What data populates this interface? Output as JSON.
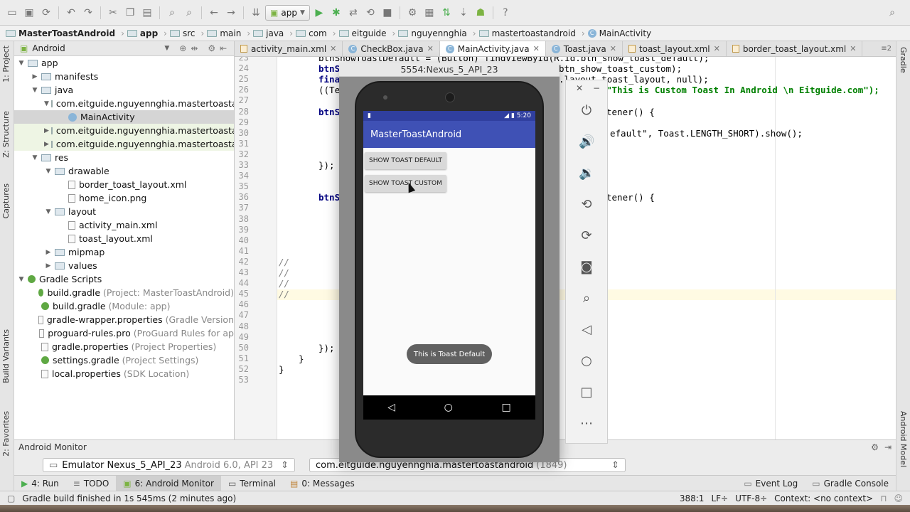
{
  "toolbar": {
    "run_config": "app"
  },
  "breadcrumb": [
    "MasterToastAndroid",
    "app",
    "src",
    "main",
    "java",
    "com",
    "eitguide",
    "nguyennghia",
    "mastertoastandroid",
    "MainActivity"
  ],
  "project": {
    "view_selector": "Android",
    "tree": [
      {
        "indent": 0,
        "arrow": "▼",
        "icon": "folder",
        "label": "app",
        "hint": ""
      },
      {
        "indent": 1,
        "arrow": "▶",
        "icon": "folder",
        "label": "manifests",
        "hint": ""
      },
      {
        "indent": 1,
        "arrow": "▼",
        "icon": "folder",
        "label": "java",
        "hint": ""
      },
      {
        "indent": 2,
        "arrow": "▼",
        "icon": "pkg",
        "label": "com.eitguide.nguyennghia.mastertoasta",
        "hint": ""
      },
      {
        "indent": 3,
        "arrow": "",
        "icon": "class",
        "label": "MainActivity",
        "hint": ""
      },
      {
        "indent": 2,
        "arrow": "▶",
        "icon": "pkg",
        "label": "com.eitguide.nguyennghia.mastertoasta",
        "hint": ""
      },
      {
        "indent": 2,
        "arrow": "▶",
        "icon": "pkg",
        "label": "com.eitguide.nguyennghia.mastertoasta",
        "hint": ""
      },
      {
        "indent": 1,
        "arrow": "▼",
        "icon": "folder",
        "label": "res",
        "hint": ""
      },
      {
        "indent": 2,
        "arrow": "▼",
        "icon": "folder",
        "label": "drawable",
        "hint": ""
      },
      {
        "indent": 3,
        "arrow": "",
        "icon": "file",
        "label": "border_toast_layout.xml",
        "hint": ""
      },
      {
        "indent": 3,
        "arrow": "",
        "icon": "file",
        "label": "home_icon.png",
        "hint": ""
      },
      {
        "indent": 2,
        "arrow": "▼",
        "icon": "folder",
        "label": "layout",
        "hint": ""
      },
      {
        "indent": 3,
        "arrow": "",
        "icon": "file",
        "label": "activity_main.xml",
        "hint": ""
      },
      {
        "indent": 3,
        "arrow": "",
        "icon": "file",
        "label": "toast_layout.xml",
        "hint": ""
      },
      {
        "indent": 2,
        "arrow": "▶",
        "icon": "folder",
        "label": "mipmap",
        "hint": ""
      },
      {
        "indent": 2,
        "arrow": "▶",
        "icon": "folder",
        "label": "values",
        "hint": ""
      },
      {
        "indent": 0,
        "arrow": "▼",
        "icon": "gradle",
        "label": "Gradle Scripts",
        "hint": ""
      },
      {
        "indent": 1,
        "arrow": "",
        "icon": "gradle",
        "label": "build.gradle",
        "hint": "(Project: MasterToastAndroid)"
      },
      {
        "indent": 1,
        "arrow": "",
        "icon": "gradle",
        "label": "build.gradle",
        "hint": "(Module: app)"
      },
      {
        "indent": 1,
        "arrow": "",
        "icon": "file",
        "label": "gradle-wrapper.properties",
        "hint": "(Gradle Version"
      },
      {
        "indent": 1,
        "arrow": "",
        "icon": "file",
        "label": "proguard-rules.pro",
        "hint": "(ProGuard Rules for ap"
      },
      {
        "indent": 1,
        "arrow": "",
        "icon": "file",
        "label": "gradle.properties",
        "hint": "(Project Properties)"
      },
      {
        "indent": 1,
        "arrow": "",
        "icon": "gradle",
        "label": "settings.gradle",
        "hint": "(Project Settings)"
      },
      {
        "indent": 1,
        "arrow": "",
        "icon": "file",
        "label": "local.properties",
        "hint": "(SDK Location)"
      }
    ]
  },
  "left_strip": {
    "project": "1: Project",
    "structure": "Z: Structure",
    "captures": "Captures",
    "build_variants": "Build Variants",
    "favorites": "2: Favorites"
  },
  "right_strip": {
    "gradle": "Gradle",
    "android_model": "Android Model"
  },
  "tabs": [
    {
      "label": "activity_main.xml",
      "active": false
    },
    {
      "label": "CheckBox.java",
      "active": false
    },
    {
      "label": "MainActivity.java",
      "active": true
    },
    {
      "label": "Toast.java",
      "active": false
    },
    {
      "label": "toast_layout.xml",
      "active": false
    },
    {
      "label": "border_toast_layout.xml",
      "active": false
    }
  ],
  "tabs_overflow": "≡2",
  "editor": {
    "line_numbers": [
      "23",
      "24",
      "25",
      "26",
      "27",
      "28",
      "29",
      "30",
      "31",
      "32",
      "33",
      "34",
      "35",
      "36",
      "37",
      "38",
      "39",
      "40",
      "41",
      "42",
      "43",
      "44",
      "45",
      "46",
      "47",
      "48",
      "49",
      "50",
      "51",
      "52",
      "53"
    ],
    "left_frags": {
      "l23": "btnShowToastDefault = (Button) findViewById(R.id.btn_show_toast_default);",
      "l24": "btnS",
      "l25": "fina",
      "l26": "((Te",
      "l28": "btnS",
      "l33": "});",
      "l36": "btnS",
      "l42": "//",
      "l43": "//",
      "l44": "//",
      "l45": "//",
      "l50": "});",
      "l51": "}",
      "l52": "}"
    },
    "right_frags": {
      "l24": "btn_show_toast_custom);",
      "l25": ".layout.toast_layout, null);",
      "l26": "\"This is Custom Toast In Android \\n Eitguide.com\");",
      "l28": "tener() {",
      "l30": "efault\", Toast.LENGTH_SHORT).show();",
      "l36": "tener() {"
    }
  },
  "emulator": {
    "title": "5554:Nexus_5_API_23",
    "time": "5:20",
    "app_title": "MasterToastAndroid",
    "button_default": "SHOW TOAST DEFAULT",
    "button_custom": "SHOW TOAST CUSTOM",
    "toast": "This is Toast Default"
  },
  "monitor": {
    "title": "Android Monitor",
    "device": "Emulator Nexus_5_API_23",
    "device_hint": "Android 6.0, API 23",
    "process": "com.eitguide.nguyennghia.mastertoastandroid",
    "process_hint": "(1849)"
  },
  "bottom_tabs": {
    "run": "4: Run",
    "todo": "TODO",
    "monitor": "6: Android Monitor",
    "terminal": "Terminal",
    "messages": "0: Messages",
    "event_log": "Event Log",
    "gradle_console": "Gradle Console"
  },
  "status": {
    "message": "Gradle build finished in 1s 545ms (2 minutes ago)",
    "position": "388:1",
    "line_sep": "LF÷",
    "encoding": "UTF-8÷",
    "context": "Context: <no context>"
  }
}
